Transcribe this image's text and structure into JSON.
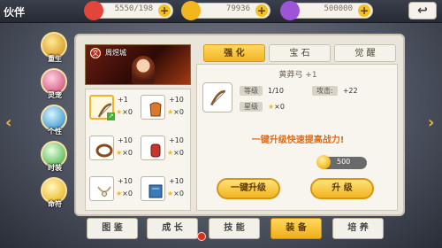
{
  "header": {
    "title": "伙伴",
    "resources": [
      {
        "name": "stamina",
        "value": "5550/198",
        "icon": "heart-icon",
        "color": "#e2463a"
      },
      {
        "name": "gold",
        "value": "79936",
        "icon": "coin-icon",
        "color": "#f3b61e"
      },
      {
        "name": "gems",
        "value": "500000",
        "icon": "gem-icon",
        "color": "#9d54d9"
      }
    ],
    "plus_label": "+",
    "back_icon": "return-icon"
  },
  "side_menu": {
    "items": [
      {
        "label": "重生",
        "icon": "angel-icon"
      },
      {
        "label": "灵宠",
        "icon": "pet-icon"
      },
      {
        "label": "个性",
        "icon": "cloud-icon"
      },
      {
        "label": "时装",
        "icon": "bottle-icon"
      },
      {
        "label": "命符",
        "icon": "talisman-icon"
      }
    ]
  },
  "arrows": {
    "left": "‹",
    "right": "›"
  },
  "hero": {
    "name": "周煜城",
    "badge": "文"
  },
  "equipment": [
    {
      "level": "+1",
      "stars": "0",
      "selected": true,
      "upgradable": true,
      "icon": "bow-icon"
    },
    {
      "level": "+10",
      "stars": "0",
      "selected": false,
      "upgradable": false,
      "icon": "armor-icon"
    },
    {
      "level": "+10",
      "stars": "0",
      "selected": false,
      "upgradable": false,
      "icon": "belt-icon"
    },
    {
      "level": "+10",
      "stars": "0",
      "selected": false,
      "upgradable": false,
      "icon": "bracer-icon"
    },
    {
      "level": "+10",
      "stars": "0",
      "selected": false,
      "upgradable": false,
      "icon": "necklace-icon"
    },
    {
      "level": "+10",
      "stars": "0",
      "selected": false,
      "upgradable": false,
      "icon": "book-icon"
    }
  ],
  "star_prefix": "×",
  "tabs": [
    {
      "label": "强 化",
      "active": true
    },
    {
      "label": "宝 石",
      "active": false
    },
    {
      "label": "觉 醒",
      "active": false
    }
  ],
  "detail": {
    "item_name": "黄莽弓 +1",
    "level_label": "等级",
    "level_value": "1/10",
    "attack_label": "攻击:",
    "attack_value": "+22",
    "star_label": "星级",
    "star_value": "×0",
    "hint": "一键升级快速提高战力!",
    "cost": "500",
    "btn_one_click": "一键升级",
    "btn_upgrade": "升 级"
  },
  "bottom_tabs": [
    {
      "label": "图 鉴",
      "active": false
    },
    {
      "label": "成 长",
      "active": false
    },
    {
      "label": "技 能",
      "active": false
    },
    {
      "label": "装 备",
      "active": true
    },
    {
      "label": "培 养",
      "active": false
    }
  ]
}
